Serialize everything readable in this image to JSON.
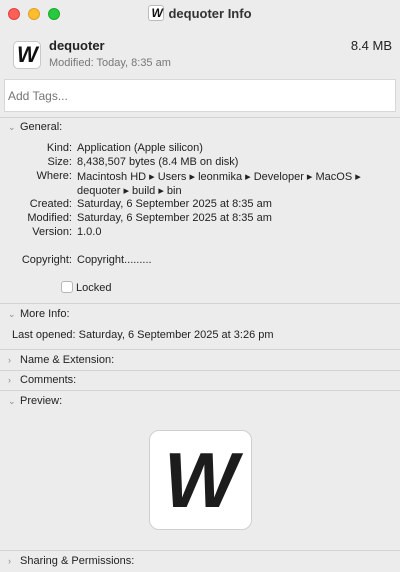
{
  "window": {
    "title": "dequoter Info",
    "icon": "app-w-icon"
  },
  "header": {
    "name": "dequoter",
    "size": "8.4 MB",
    "modified": "Modified: Today, 8:35 am"
  },
  "tags": {
    "placeholder": "Add Tags..."
  },
  "general": {
    "heading": "General:",
    "kind_label": "Kind:",
    "kind": "Application (Apple silicon)",
    "size_label": "Size:",
    "size": "8,438,507 bytes (8.4 MB on disk)",
    "where_label": "Where:",
    "where_line1": "Macintosh HD ▸ Users ▸ leonmika ▸ Developer ▸ MacOS ▸",
    "where_line2": "dequoter ▸ build ▸ bin",
    "created_label": "Created:",
    "created": "Saturday, 6 September 2025 at 8:35 am",
    "modified_label": "Modified:",
    "modified": "Saturday, 6 September 2025 at 8:35 am",
    "version_label": "Version:",
    "version": "1.0.0",
    "copyright_label": "Copyright:",
    "copyright": "Copyright.........",
    "locked_label": "Locked",
    "locked": false
  },
  "more_info": {
    "heading": "More Info:",
    "last_opened": "Last opened: Saturday, 6 September 2025 at 3:26 pm"
  },
  "name_ext": {
    "heading": "Name & Extension:"
  },
  "comments": {
    "heading": "Comments:"
  },
  "preview": {
    "heading": "Preview:",
    "glyph": "W"
  },
  "sharing": {
    "heading": "Sharing & Permissions:"
  },
  "colors": {
    "close": "#fe5f57",
    "minimize": "#febc2e",
    "zoom": "#28c840"
  }
}
